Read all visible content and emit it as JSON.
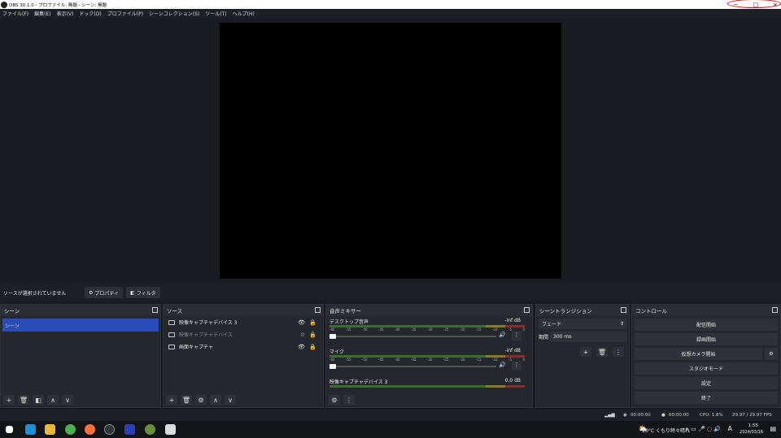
{
  "window": {
    "title": "OBS 30.1.0 - プロファイル: 無題 - シーン: 無題",
    "minimize": "−",
    "maximize": "□",
    "close": "×"
  },
  "menu": [
    "ファイル(F)",
    "編集(E)",
    "表示(V)",
    "ドック(D)",
    "プロファイル(P)",
    "シーンコレクション(S)",
    "ツール(T)",
    "ヘルプ(H)"
  ],
  "sourcebar": {
    "message": "ソースが選択されていません",
    "properties": "プロパティ",
    "filters": "フィルタ"
  },
  "scenes": {
    "title": "シーン",
    "items": [
      "シーン"
    ]
  },
  "sources": {
    "title": "ソース",
    "items": [
      {
        "label": "映像キャプチャデバイス 3",
        "visible": true
      },
      {
        "label": "映像キャプチャデバイス",
        "visible": false
      },
      {
        "label": "画面キャプチャ",
        "visible": true
      }
    ]
  },
  "mixer": {
    "title": "音声ミキサー",
    "ticks": [
      "-60",
      "-55",
      "-50",
      "-45",
      "-40",
      "-35",
      "-30",
      "-25",
      "-20",
      "-15",
      "-10",
      "-5",
      "0"
    ],
    "channels": [
      {
        "name": "デスクトップ音声",
        "db": "-inf dB"
      },
      {
        "name": "マイク",
        "db": "-inf dB"
      },
      {
        "name": "映像キャプチャデバイス 3",
        "db": "0.0 dB"
      }
    ]
  },
  "transitions": {
    "title": "シーントランジション",
    "type": "フェード",
    "duration_label": "期間",
    "duration": "300 ms"
  },
  "controls": {
    "title": "コントロール",
    "buttons": [
      "配信開始",
      "録画開始",
      "仮想カメラ開始",
      "スタジオモード",
      "設定",
      "終了"
    ]
  },
  "status": {
    "stream_time": "00:00:00",
    "rec_time": "00:00:00",
    "cpu": "CPU: 1.8%",
    "fps": "29.97 / 29.97 FPS"
  },
  "taskbar": {
    "weather": "20°C くもり時々晴れ",
    "ime": "A",
    "time": "1:55",
    "date": "2024/03/16"
  }
}
